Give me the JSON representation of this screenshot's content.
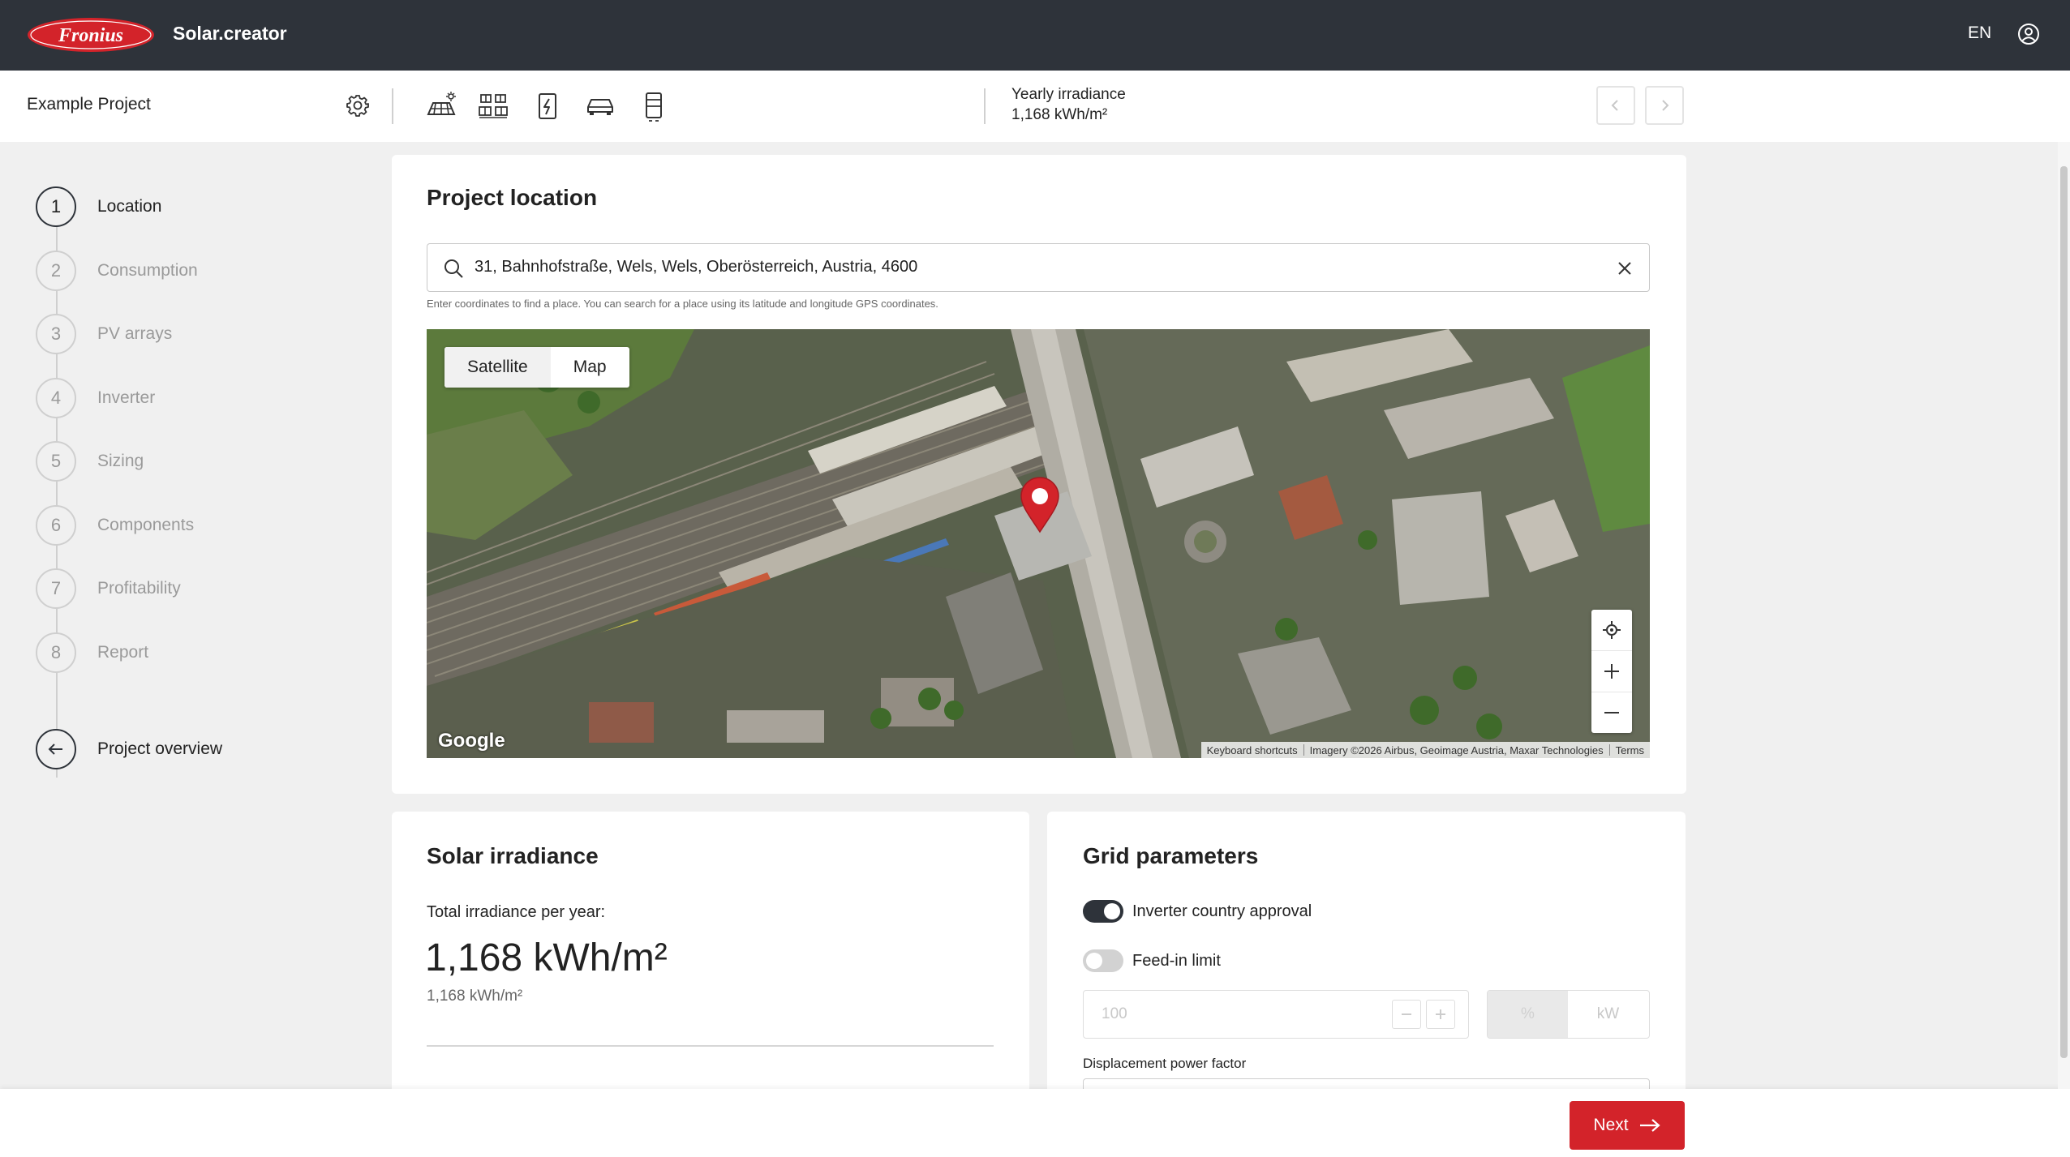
{
  "header": {
    "brand": "Fronius",
    "app_name": "Solar.creator",
    "language": "EN",
    "icons": [
      "user-account-icon"
    ]
  },
  "project_bar": {
    "project_name": "Example Project",
    "toolbar_icons": [
      "settings-gear-icon",
      "pv-roof-icon",
      "pv-array-icon",
      "inverter-icon",
      "ev-car-icon",
      "battery-icon"
    ],
    "irradiance_label": "Yearly irradiance",
    "irradiance_value": "1,168 kWh/m²"
  },
  "steps": [
    {
      "num": "1",
      "label": "Location",
      "active": true
    },
    {
      "num": "2",
      "label": "Consumption",
      "active": false
    },
    {
      "num": "3",
      "label": "PV arrays",
      "active": false
    },
    {
      "num": "4",
      "label": "Inverter",
      "active": false
    },
    {
      "num": "5",
      "label": "Sizing",
      "active": false
    },
    {
      "num": "6",
      "label": "Components",
      "active": false
    },
    {
      "num": "7",
      "label": "Profitability",
      "active": false
    },
    {
      "num": "8",
      "label": "Report",
      "active": false
    }
  ],
  "overview_label": "Project overview",
  "location": {
    "title": "Project location",
    "search_value": "31, Bahnhofstraße, Wels, Wels, Oberösterreich, Austria, 4600",
    "hint": "Enter coordinates to find a place. You can search for a place using its latitude and longitude GPS coordinates.",
    "map": {
      "tab_satellite": "Satellite",
      "tab_map": "Map",
      "selected_tab": "Satellite",
      "google": "Google",
      "keyboard": "Keyboard shortcuts",
      "imagery": "Imagery ©2026 Airbus, Geoimage Austria, Maxar Technologies",
      "terms": "Terms"
    }
  },
  "irradiance": {
    "title": "Solar irradiance",
    "total_label": "Total irradiance per year:",
    "total_big": "1,168 kWh/m²",
    "total_small": "1,168 kWh/m²"
  },
  "grid": {
    "title": "Grid parameters",
    "inverter_approval": "Inverter country approval",
    "inverter_approval_on": true,
    "feed_in_limit": "Feed-in limit",
    "feed_in_limit_on": false,
    "feed_in_value": "100",
    "unit_percent": "%",
    "unit_kw": "kW",
    "displacement_label": "Displacement power factor"
  },
  "footer": {
    "next_label": "Next"
  },
  "colors": {
    "header_bg": "#2e333a",
    "brand_red": "#d3232a",
    "page_bg": "#f0f0f0"
  }
}
